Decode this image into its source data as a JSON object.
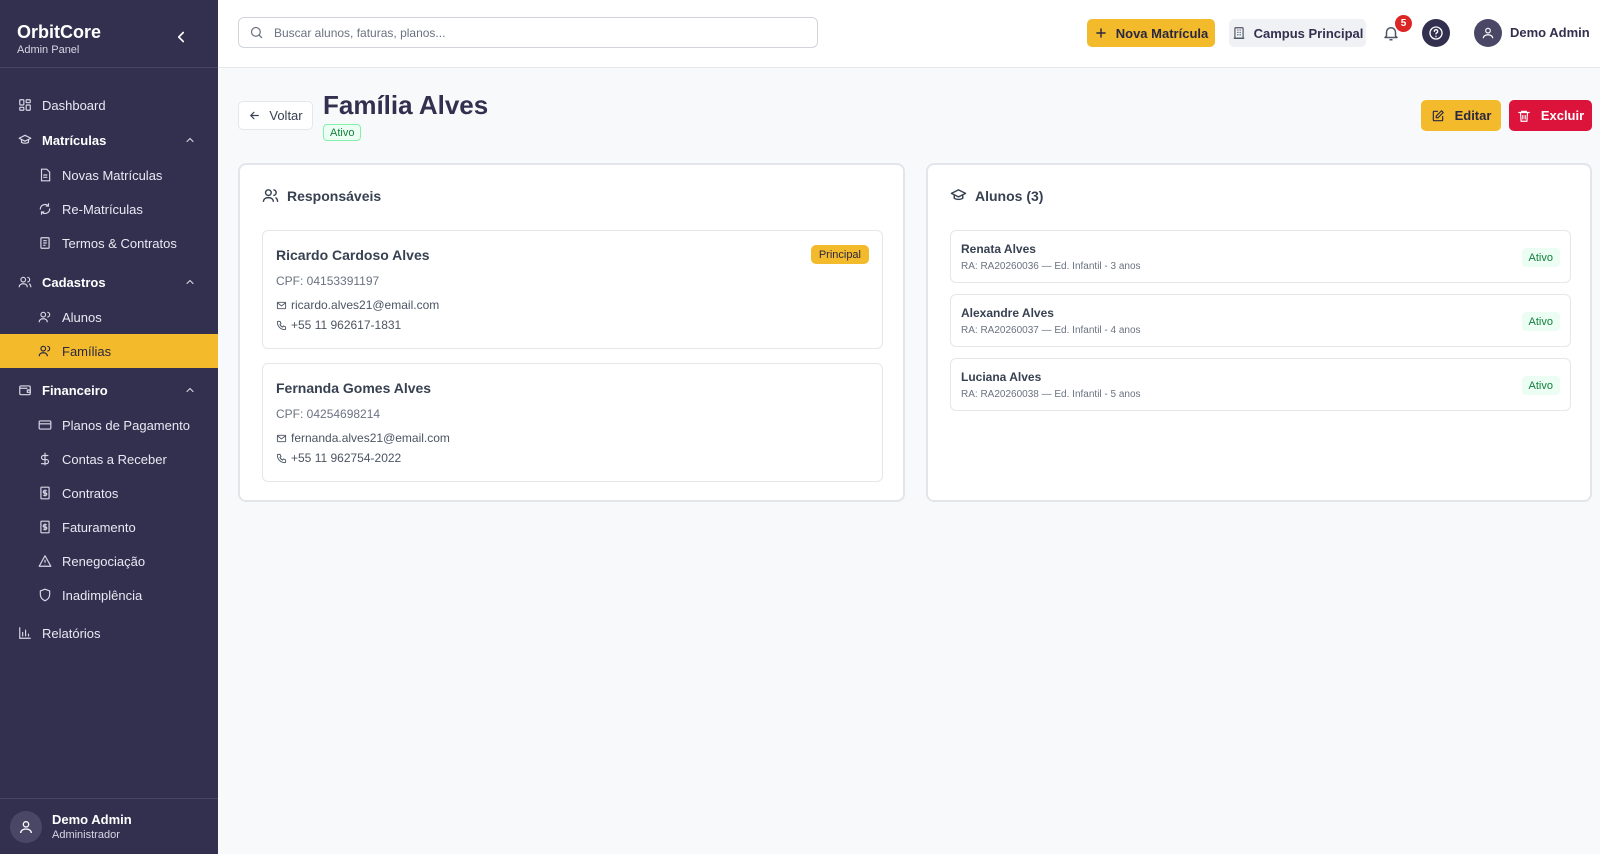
{
  "app": {
    "name": "OrbitCore",
    "subtitle": "Admin Panel"
  },
  "sidebar": {
    "items": [
      {
        "label": "Dashboard"
      },
      {
        "label": "Matrículas"
      },
      {
        "label": "Novas Matrículas"
      },
      {
        "label": "Re-Matrículas"
      },
      {
        "label": "Termos & Contratos"
      },
      {
        "label": "Cadastros"
      },
      {
        "label": "Alunos"
      },
      {
        "label": "Famílias"
      },
      {
        "label": "Financeiro"
      },
      {
        "label": "Planos de Pagamento"
      },
      {
        "label": "Contas a Receber"
      },
      {
        "label": "Contratos"
      },
      {
        "label": "Faturamento"
      },
      {
        "label": "Renegociação"
      },
      {
        "label": "Inadimplência"
      },
      {
        "label": "Relatórios"
      }
    ],
    "active_item": "Famílias",
    "user": {
      "name": "Demo Admin",
      "role": "Administrador"
    }
  },
  "topbar": {
    "search_placeholder": "Buscar alunos, faturas, planos...",
    "new_enrollment": "Nova Matrícula",
    "campus": "Campus Principal",
    "notifications_count": "5",
    "user_name": "Demo Admin"
  },
  "page": {
    "back_label": "Voltar",
    "title": "Família Alves",
    "status": "Ativo",
    "edit_label": "Editar",
    "delete_label": "Excluir"
  },
  "responsaveis": {
    "title": "Responsáveis",
    "items": [
      {
        "name": "Ricardo Cardoso Alves",
        "cpf": "CPF: 04153391197",
        "email": "ricardo.alves21@email.com",
        "phone": "+55 11 962617-1831",
        "badge": "Principal"
      },
      {
        "name": "Fernanda Gomes Alves",
        "cpf": "CPF: 04254698214",
        "email": "fernanda.alves21@email.com",
        "phone": "+55 11 962754-2022"
      }
    ]
  },
  "alunos": {
    "title": "Alunos (3)",
    "items": [
      {
        "name": "Renata Alves",
        "meta": "RA: RA20260036 — Ed. Infantil - 3 anos",
        "status": "Ativo"
      },
      {
        "name": "Alexandre Alves",
        "meta": "RA: RA20260037 — Ed. Infantil - 4 anos",
        "status": "Ativo"
      },
      {
        "name": "Luciana Alves",
        "meta": "RA: RA20260038 — Ed. Infantil - 5 anos",
        "status": "Ativo"
      }
    ]
  },
  "colors": {
    "sidebar_bg": "#33304f",
    "accent": "#f3bb2c",
    "danger": "#dc143c",
    "success": "#15803d"
  }
}
